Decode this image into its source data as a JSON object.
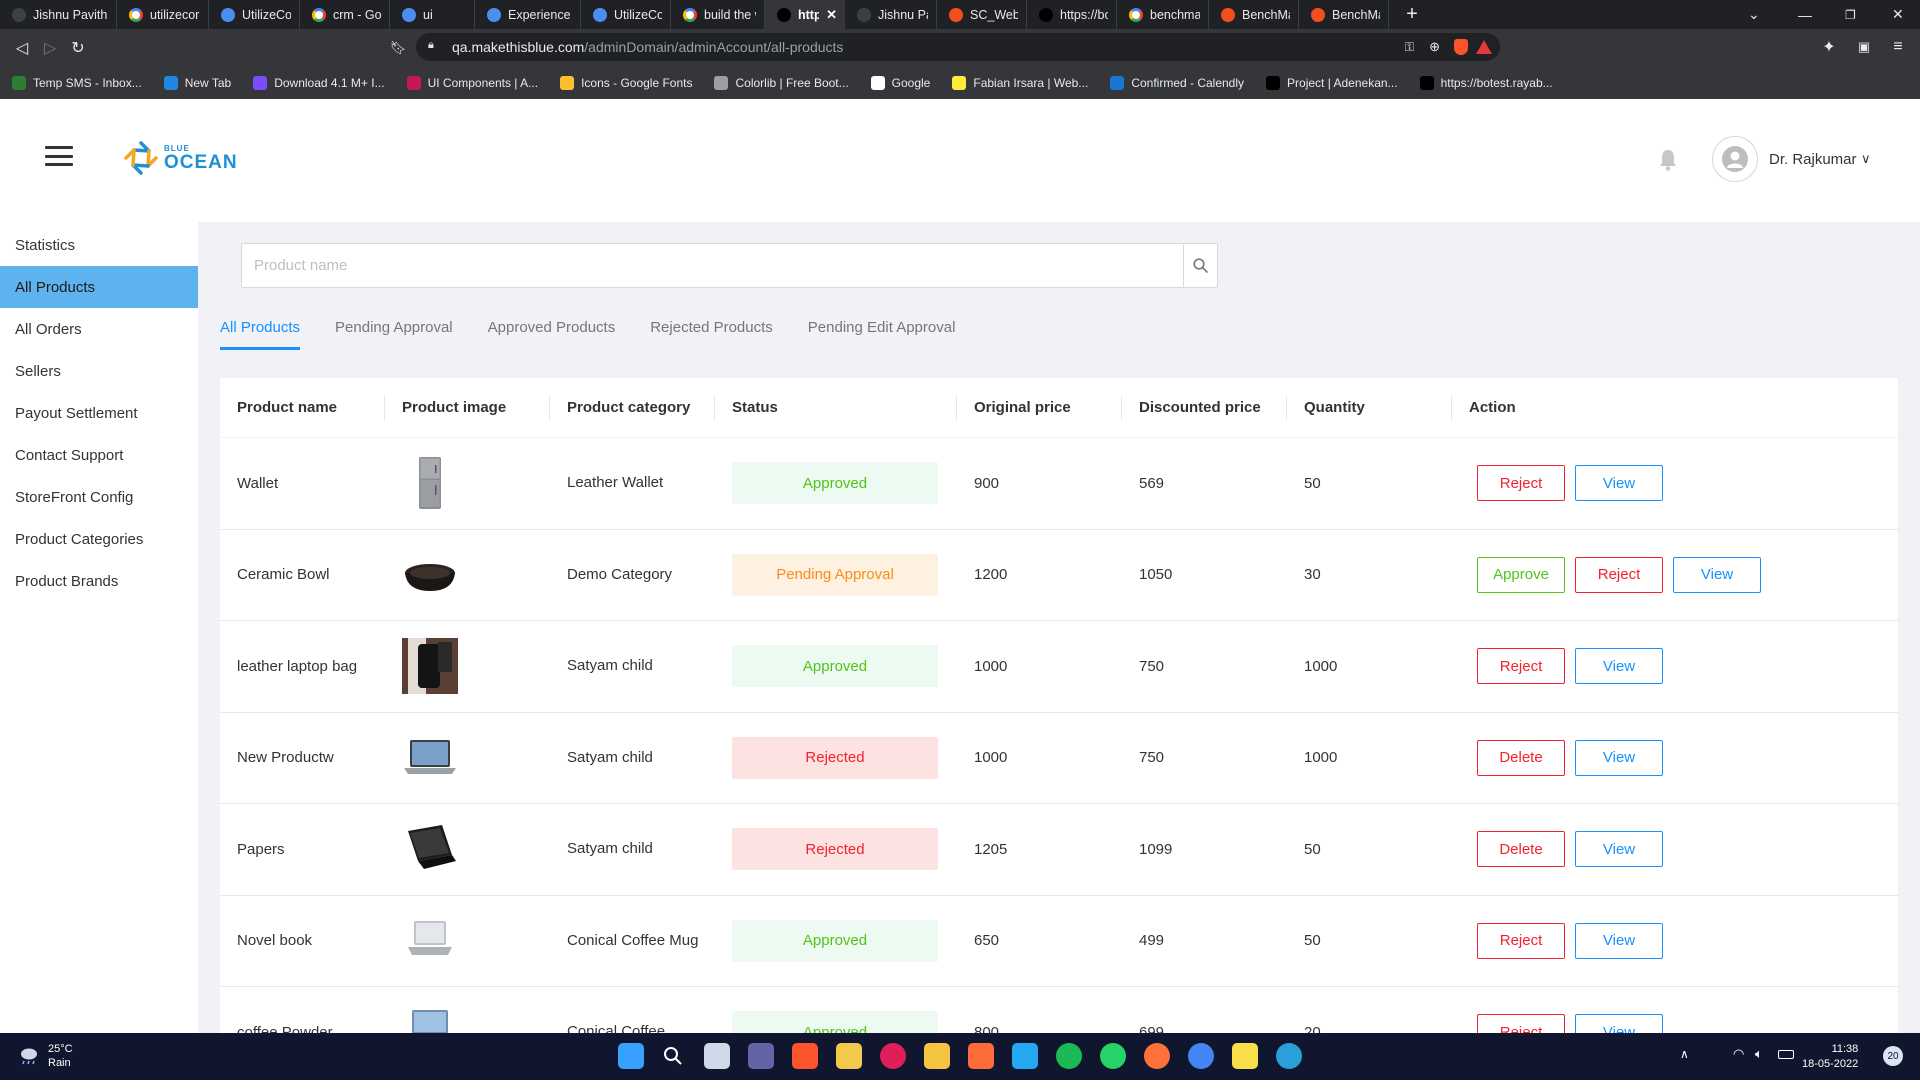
{
  "browser": {
    "tabs": [
      {
        "label": "Jishnu Pavithr",
        "icon": "jp-icon",
        "color": "#3c4043"
      },
      {
        "label": "utilizecore - G",
        "icon": "google-icon",
        "color": "#ffffff"
      },
      {
        "label": "UtilizeCore Sa",
        "icon": "utilizecore-icon",
        "color": "#4a8ff0"
      },
      {
        "label": "crm - Google",
        "icon": "google-icon",
        "color": "#ffffff"
      },
      {
        "label": "ui",
        "icon": "ui-icon",
        "color": "#4a8ff0"
      },
      {
        "label": "Experience : C",
        "icon": "experience-icon",
        "color": "#4a8ff0"
      },
      {
        "label": "UtilizeCore Sa",
        "icon": "utilizecore-icon",
        "color": "#4a8ff0"
      },
      {
        "label": "build the web",
        "icon": "google-icon",
        "color": "#ffffff"
      },
      {
        "label": "https://qa",
        "icon": "vercel-icon",
        "color": "#000000",
        "active": true
      },
      {
        "label": "Jishnu Pavithr",
        "icon": "jp-icon",
        "color": "#3c4043"
      },
      {
        "label": "SC_Website_D",
        "icon": "figma-icon",
        "color": "#f24e1e"
      },
      {
        "label": "https://botest",
        "icon": "vercel-icon",
        "color": "#000000"
      },
      {
        "label": "benchmark - G",
        "icon": "google-icon",
        "color": "#ffffff"
      },
      {
        "label": "BenchMark –",
        "icon": "figma-icon",
        "color": "#f24e1e"
      },
      {
        "label": "BenchMark –",
        "icon": "figma-icon",
        "color": "#f24e1e"
      }
    ],
    "url_host": "qa.makethisblue.com",
    "url_path": "/adminDomain/adminAccount/all-products",
    "bookmarks": [
      {
        "label": "Temp SMS - Inbox...",
        "color": "#2e7d32"
      },
      {
        "label": "New Tab",
        "color": "#1e88e5"
      },
      {
        "label": "Download 4.1 M+ I...",
        "color": "#7c4dff"
      },
      {
        "label": "UI Components | A...",
        "color": "#c2185b"
      },
      {
        "label": "Icons - Google Fonts",
        "color": "#fbc02d"
      },
      {
        "label": "Colorlib | Free Boot...",
        "color": "#9e9e9e"
      },
      {
        "label": "Google",
        "color": "#ffffff"
      },
      {
        "label": "Fabian Irsara | Web...",
        "color": "#ffeb3b"
      },
      {
        "label": "Confirmed - Calendly",
        "color": "#1976d2"
      },
      {
        "label": "Project | Adenekan...",
        "color": "#000000"
      },
      {
        "label": "https://botest.rayab...",
        "color": "#000000"
      }
    ]
  },
  "app": {
    "logo_small": "BLUE",
    "logo_big": "OCEAN",
    "user_name": "Dr. Rajkumar",
    "brand_color": "#1890ff"
  },
  "sidebar": {
    "items": [
      {
        "label": "Statistics"
      },
      {
        "label": "All Products",
        "active": true
      },
      {
        "label": "All Orders"
      },
      {
        "label": "Sellers"
      },
      {
        "label": "Payout Settlement"
      },
      {
        "label": "Contact Support"
      },
      {
        "label": "StoreFront Config"
      },
      {
        "label": "Product Categories"
      },
      {
        "label": "Product Brands"
      }
    ]
  },
  "search": {
    "placeholder": "Product name",
    "value": ""
  },
  "tabs": [
    {
      "label": "All Products",
      "active": true
    },
    {
      "label": "Pending Approval"
    },
    {
      "label": "Approved Products"
    },
    {
      "label": "Rejected Products"
    },
    {
      "label": "Pending Edit Approval"
    }
  ],
  "table": {
    "columns": [
      "Product name",
      "Product image",
      "Product category",
      "Status",
      "Original price",
      "Discounted price",
      "Quantity",
      "Action"
    ],
    "rows": [
      {
        "name": "Wallet",
        "image": "fridge-image",
        "category": "Leather Wallet",
        "status": "Approved",
        "status_type": "approved",
        "original": "900",
        "discounted": "569",
        "qty": "50",
        "actions": [
          "Reject",
          "View"
        ]
      },
      {
        "name": "Ceramic Bowl",
        "image": "bowl-image",
        "category": "Demo Category",
        "status": "Pending Approval",
        "status_type": "pending",
        "original": "1200",
        "discounted": "1050",
        "qty": "30",
        "actions": [
          "Approve",
          "Reject",
          "View"
        ]
      },
      {
        "name": "leather laptop bag",
        "image": "backpack-image",
        "category": "Satyam child",
        "status": "Approved",
        "status_type": "approved",
        "original": "1000",
        "discounted": "750",
        "qty": "1000",
        "actions": [
          "Reject",
          "View"
        ]
      },
      {
        "name": "New Productw",
        "image": "laptop-image",
        "category": "Satyam child",
        "status": "Rejected",
        "status_type": "rejected",
        "original": "1000",
        "discounted": "750",
        "qty": "1000",
        "actions": [
          "Delete",
          "View"
        ]
      },
      {
        "name": "Papers",
        "image": "laptop-dark-image",
        "category": "Satyam child",
        "status": "Rejected",
        "status_type": "rejected",
        "original": "1205",
        "discounted": "1099",
        "qty": "50",
        "actions": [
          "Delete",
          "View"
        ]
      },
      {
        "name": "Novel book",
        "image": "laptop-silver-image",
        "category": "Conical Coffee Mug",
        "status": "Approved",
        "status_type": "approved",
        "original": "650",
        "discounted": "499",
        "qty": "50",
        "actions": [
          "Reject",
          "View"
        ]
      },
      {
        "name": "coffee Powder",
        "image": "monitor-image",
        "category": "Conical Coffee",
        "status": "Approved",
        "status_type": "approved",
        "original": "800",
        "discounted": "699",
        "qty": "20",
        "actions": [
          "Reject",
          "View"
        ]
      }
    ]
  },
  "taskbar": {
    "temperature": "25°C",
    "weather": "Rain",
    "time": "11:38",
    "date": "18-05-2022",
    "notifications": "20"
  }
}
